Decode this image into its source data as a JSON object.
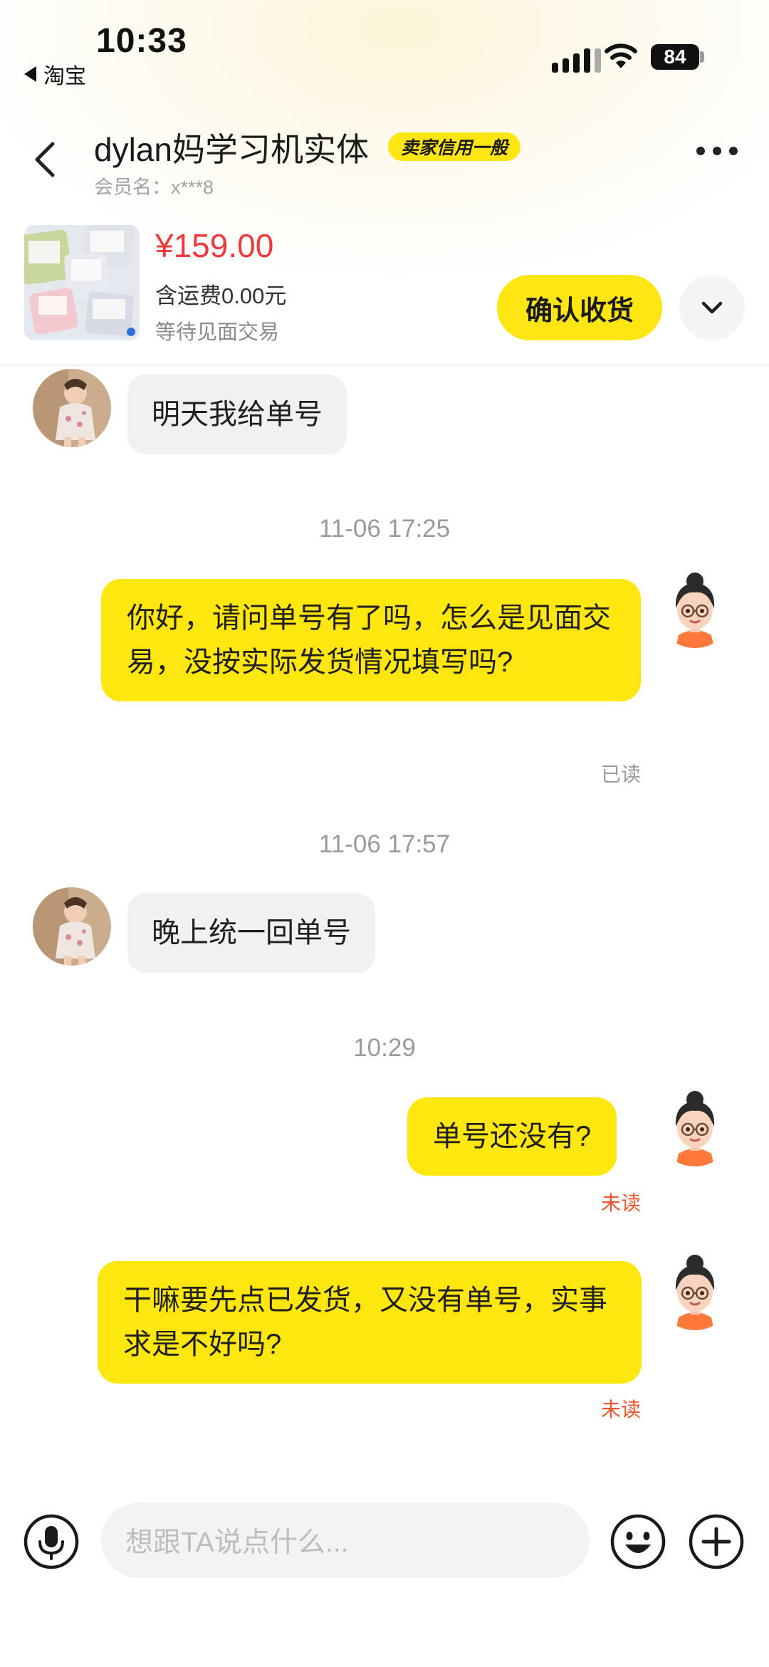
{
  "status_bar": {
    "time": "10:33",
    "back_app": "淘宝",
    "battery": "84"
  },
  "header": {
    "seller_name": "dylan妈学习机实体",
    "credit_badge": "卖家信用一般",
    "member_label": "会员名：x***8"
  },
  "order": {
    "price": "¥159.00",
    "shipping": "含运费0.00元",
    "status": "等待见面交易",
    "confirm_label": "确认收货"
  },
  "chat": {
    "msg1": "明天我给单号",
    "time1": "11-06 17:25",
    "msg2": "你好，请问单号有了吗，怎么是见面交易，没按实际发货情况填写吗?",
    "msg2_status": "已读",
    "time2": "11-06 17:57",
    "msg3": "晚上统一回单号",
    "time3": "10:29",
    "msg4": "单号还没有?",
    "msg4_status": "未读",
    "msg5": "干嘛要先点已发货，又没有单号，实事求是不好吗?",
    "msg5_status": "未读"
  },
  "input_bar": {
    "placeholder": "想跟TA说点什么..."
  },
  "colors": {
    "accent": "#ffe511",
    "price": "#f1393a",
    "unread": "#f2552c"
  },
  "icons": [
    "back-triangle-icon",
    "signal-icon",
    "wifi-icon",
    "battery-icon",
    "chevron-left-icon",
    "more-icon",
    "chevron-down-icon",
    "microphone-icon",
    "emoji-icon",
    "plus-icon"
  ]
}
